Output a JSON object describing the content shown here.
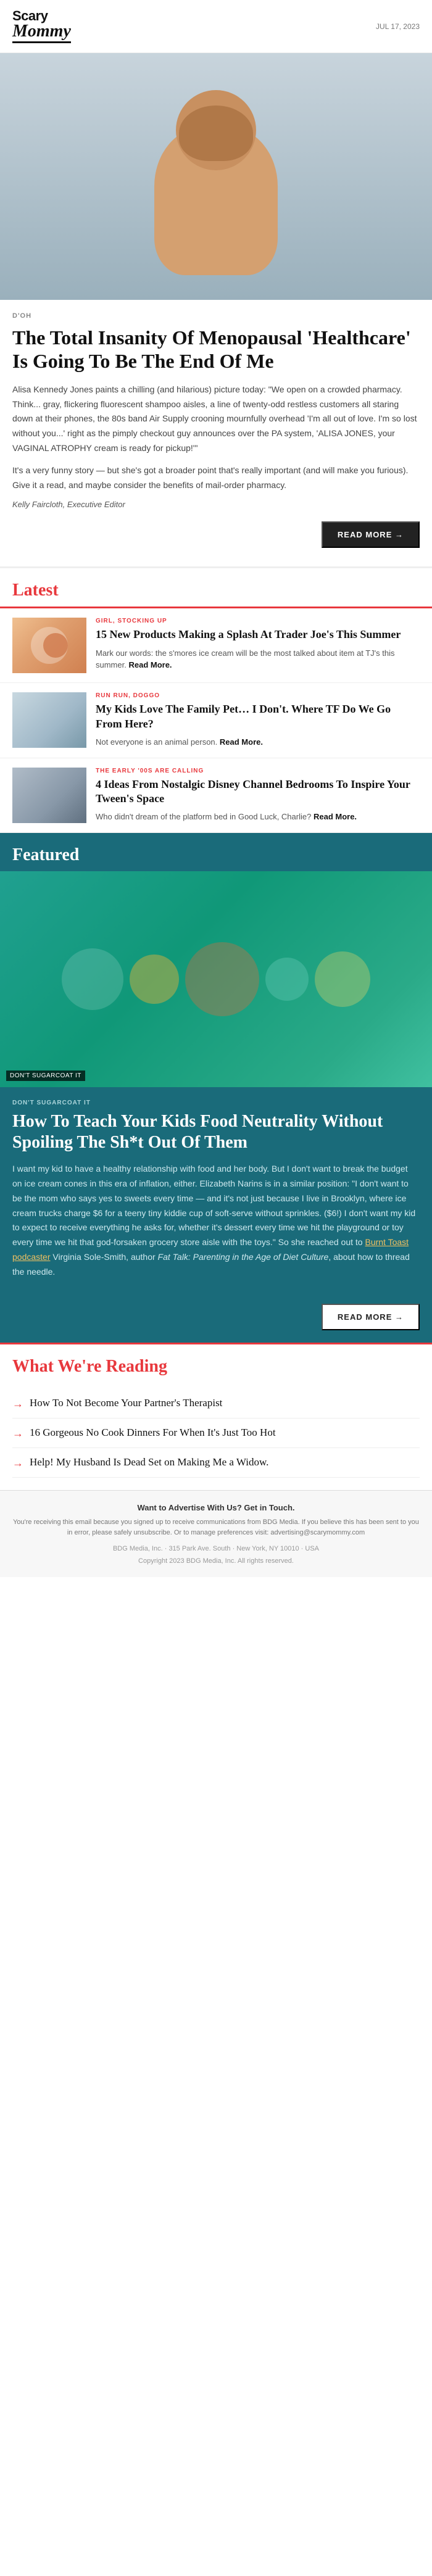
{
  "header": {
    "logo_line1": "Scary",
    "logo_line2": "Mommy",
    "date": "JUL 17, 2023"
  },
  "hero_article": {
    "tag": "D'OH",
    "title": "The Total Insanity Of Menopausal 'Healthcare' Is Going To Be The End Of Me",
    "body1": "Alisa Kennedy Jones paints a chilling (and hilarious) picture today: \"We open on a crowded pharmacy. Think... gray, flickering fluorescent shampoo aisles, a line of twenty-odd restless customers all staring down at their phones, the 80s band Air Supply crooning mournfully overhead 'I'm all out of love. I'm so lost without you...' right as the pimply checkout guy announces over the PA system, 'ALISA JONES, your VAGINAL ATROPHY cream is ready for pickup!'\"",
    "body2": "It's a very funny story — but she's got a broader point that's really important (and will make you furious). Give it a read, and maybe consider the benefits of mail-order pharmacy.",
    "author": "Kelly Faircloth, Executive Editor",
    "read_more": "READ MORE"
  },
  "latest": {
    "section_title": "Latest",
    "items": [
      {
        "category": "GIRL, STOCKING UP",
        "title": "15 New Products Making a Splash At Trader Joe's This Summer",
        "excerpt": "Mark our words: the s'mores ice cream will be the most talked about item at TJ's this summer.",
        "read_more": "Read More."
      },
      {
        "category": "RUN RUN, DOGGO",
        "title": "My Kids Love The Family Pet… I Don't. Where TF Do We Go From Here?",
        "excerpt": "Not everyone is an animal person.",
        "read_more": "Read More."
      },
      {
        "category": "THE EARLY '00S ARE CALLING",
        "title": "4 Ideas From Nostalgic Disney Channel Bedrooms To Inspire Your Tween's Space",
        "excerpt": "Who didn't dream of the platform bed in Good Luck, Charlie?",
        "read_more": "Read More."
      }
    ]
  },
  "featured": {
    "section_title": "Featured",
    "image_tag": "DON'T SUGARCOAT IT",
    "category": "DON'T SUGARCOAT IT",
    "title": "How To Teach Your Kids Food Neutrality Without Spoiling The Sh*t Out Of Them",
    "body": "I want my kid to have a healthy relationship with food and her body. But I don't want to break the budget on ice cream cones in this era of inflation, either. Elizabeth Narins is in a similar position: \"I don't want to be the mom who says yes to sweets every time — and it's not just because I live in Brooklyn, where ice cream trucks charge $6 for a teeny tiny kiddie cup of soft-serve without sprinkles. ($6!) I don't want my kid to expect to receive everything he asks for, whether it's dessert every time we hit the playground or toy every time we hit that god-forsaken grocery store aisle with the toys.\" So she reached out to Burnt Toast podcaster Virginia Sole-Smith, author Fat Talk: Parenting in the Age of Diet Culture, about how to thread the needle.",
    "link_text": "Burnt Toast podcaster",
    "read_more": "READ MORE"
  },
  "reading": {
    "section_title": "What We're Reading",
    "items": [
      "How To Not Become Your Partner's Therapist",
      "16 Gorgeous No Cook Dinners For When It's Just Too Hot",
      "Help! My Husband Is Dead Set on Making Me a Widow."
    ]
  },
  "footer": {
    "email_cta_title": "Want to Advertise With Us? Get in Touch.",
    "body": "You're receiving this email because you signed up to receive communications from BDG Media. If you believe this has been sent to you in error, please safely unsubscribe. Or to manage preferences visit: advertising@scarymommy.com",
    "company_line1": "BDG Media, Inc. · 315 Park Ave. South · New York, NY 10010 · USA",
    "company_line2": "Copyright 2023 BDG Media, Inc. All rights reserved."
  }
}
